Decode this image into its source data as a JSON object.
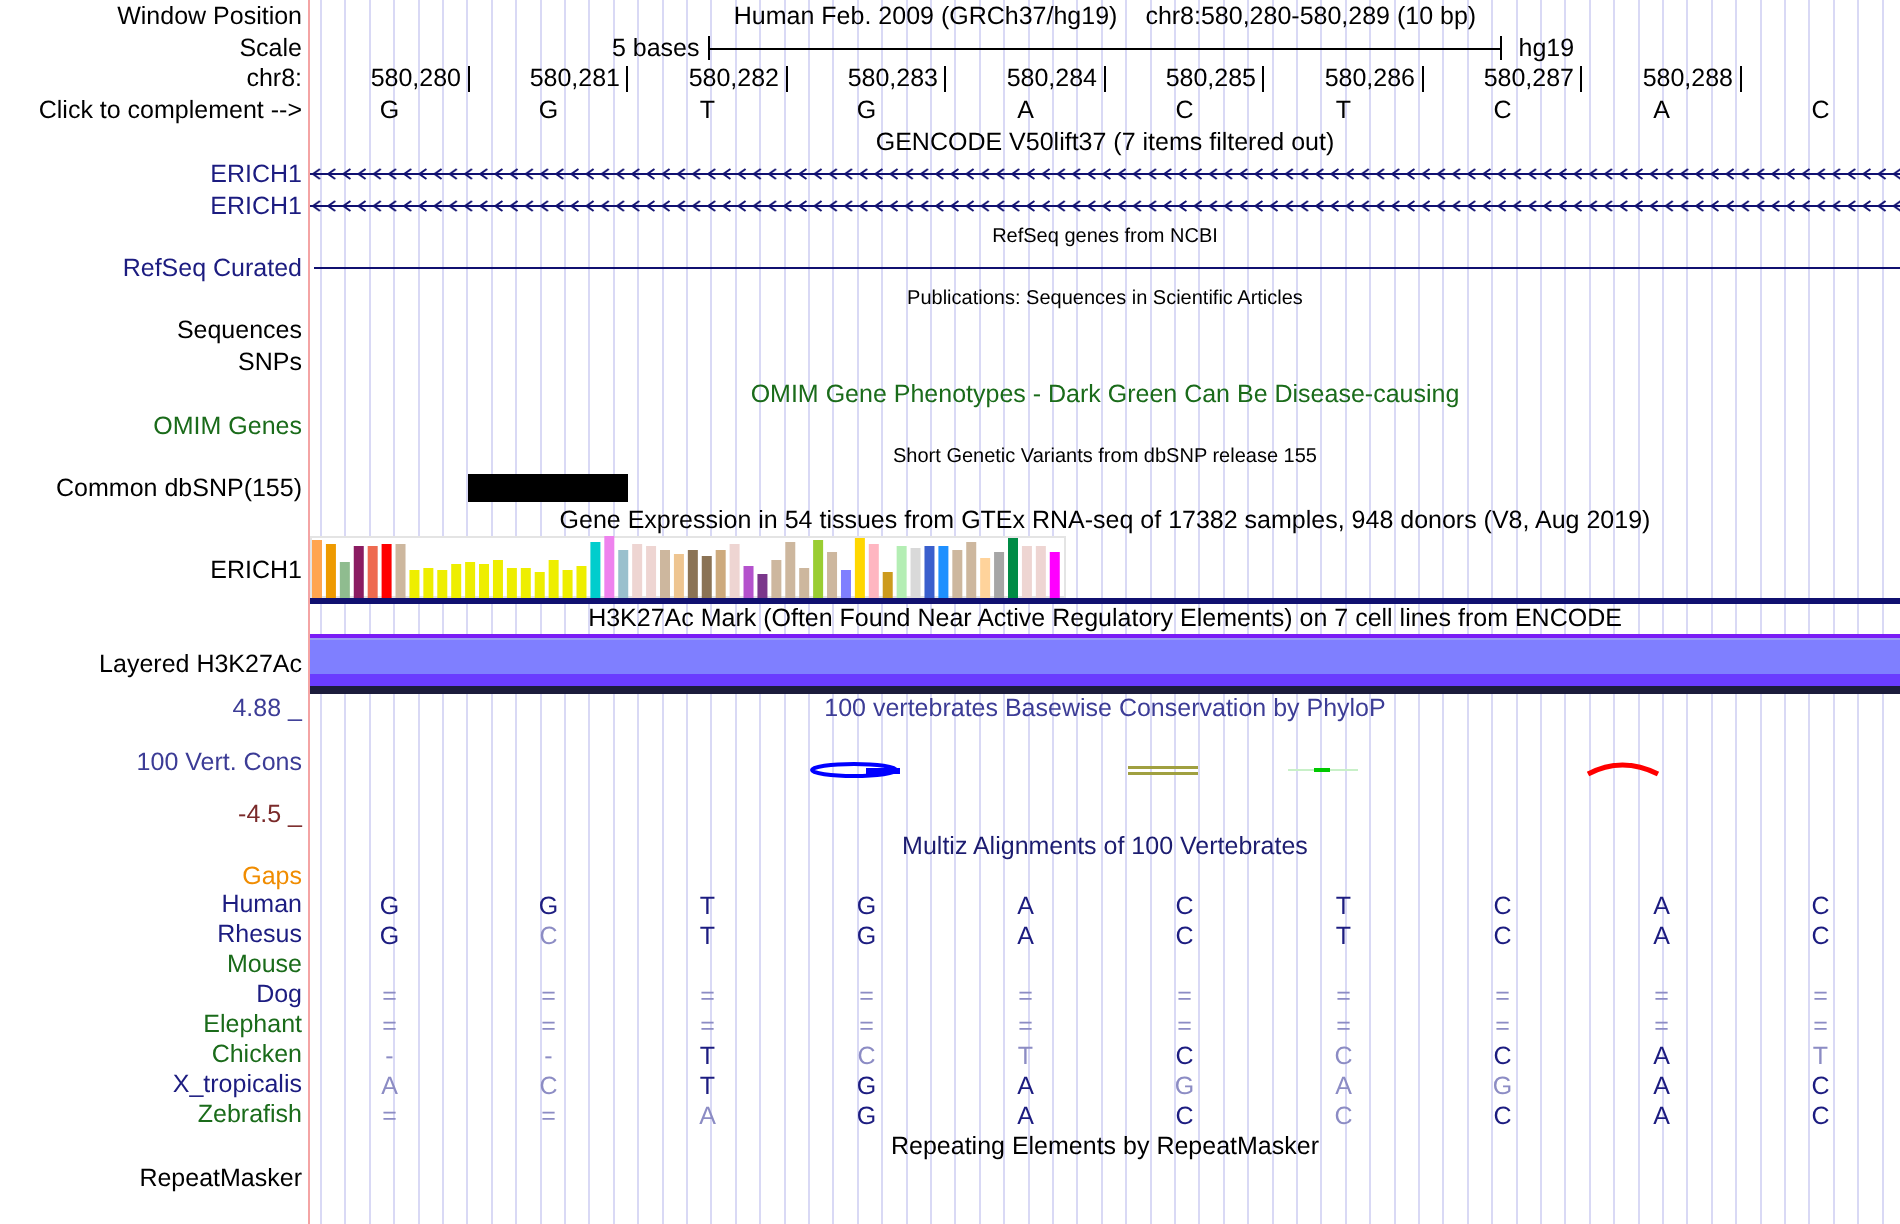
{
  "header": {
    "position_label": "Window Position",
    "title": "Human Feb. 2009 (GRCh37/hg19)",
    "location": "chr8:580,280-580,289 (10 bp)",
    "scale_label": "Scale",
    "scale_text": "5 bases",
    "assembly": "hg19",
    "chrom_label": "chr8:",
    "positions": [
      "580,280",
      "580,281",
      "580,282",
      "580,283",
      "580,284",
      "580,285",
      "580,286",
      "580,287",
      "580,288"
    ],
    "complement_label": "Click to complement -->",
    "bases": [
      "G",
      "G",
      "T",
      "G",
      "A",
      "C",
      "T",
      "C",
      "A",
      "C"
    ]
  },
  "tracks": [
    {
      "kind": "title",
      "text": "GENCODE V50lift37 (7 items filtered out)",
      "color": "#000000",
      "small": false
    },
    {
      "kind": "gene",
      "label": "ERICH1",
      "color": "#1c1c80",
      "arrows": true
    },
    {
      "kind": "gene",
      "label": "ERICH1",
      "color": "#1c1c80",
      "arrows": true
    },
    {
      "kind": "title",
      "text": "RefSeq genes from NCBI",
      "color": "#000000",
      "small": true
    },
    {
      "kind": "gene",
      "label": "RefSeq Curated",
      "color": "#1c1c80",
      "arrows": false
    },
    {
      "kind": "title",
      "text": "Publications: Sequences in Scientific Articles",
      "color": "#000000",
      "small": true
    },
    {
      "kind": "label",
      "label": "Sequences",
      "color": "#000000"
    },
    {
      "kind": "label",
      "label": "SNPs",
      "color": "#000000"
    },
    {
      "kind": "title",
      "text": "OMIM Gene Phenotypes - Dark Green Can Be Disease-causing",
      "color": "#1a6b1a",
      "small": false
    },
    {
      "kind": "label",
      "label": "OMIM Genes",
      "color": "#1a6b1a"
    },
    {
      "kind": "title",
      "text": "Short Genetic Variants from dbSNP release 155",
      "color": "#000000",
      "small": true
    },
    {
      "kind": "snp",
      "label": "Common dbSNP(155)",
      "color": "#000000"
    },
    {
      "kind": "title",
      "text": "Gene Expression in 54 tissues from GTEx RNA-seq of 17382 samples, 948 donors (V8, Aug 2019)",
      "color": "#000000",
      "small": false
    },
    {
      "kind": "bars",
      "label": "ERICH1",
      "color": "#000000"
    },
    {
      "kind": "title",
      "text": "H3K27Ac Mark (Often Found Near Active Regulatory Elements) on 7 cell lines from ENCODE",
      "color": "#000000",
      "small": false
    },
    {
      "kind": "layered",
      "label": "Layered H3K27Ac",
      "color": "#000000"
    },
    {
      "kind": "conservation",
      "max": "4.88 _",
      "label": "100 Vert. Cons",
      "min": "-4.5 _",
      "text": "100 vertebrates Basewise Conservation by PhyloP",
      "color": "#3c3c96"
    },
    {
      "kind": "title",
      "text": "Multiz Alignments of 100 Vertebrates",
      "color": "#1c1c70",
      "small": false
    },
    {
      "kind": "alignment",
      "gaps_label": "Gaps",
      "species": [
        {
          "name": "Human",
          "color": "#1c1c80",
          "bases": [
            {
              "b": "G",
              "faint": false
            },
            {
              "b": "G",
              "faint": false
            },
            {
              "b": "T",
              "faint": false
            },
            {
              "b": "G",
              "faint": false
            },
            {
              "b": "A",
              "faint": false
            },
            {
              "b": "C",
              "faint": false
            },
            {
              "b": "T",
              "faint": false
            },
            {
              "b": "C",
              "faint": false
            },
            {
              "b": "A",
              "faint": false
            },
            {
              "b": "C",
              "faint": false
            }
          ]
        },
        {
          "name": "Rhesus",
          "color": "#1c1c80",
          "bases": [
            {
              "b": "G",
              "faint": false
            },
            {
              "b": "C",
              "faint": true
            },
            {
              "b": "T",
              "faint": false
            },
            {
              "b": "G",
              "faint": false
            },
            {
              "b": "A",
              "faint": false
            },
            {
              "b": "C",
              "faint": false
            },
            {
              "b": "T",
              "faint": false
            },
            {
              "b": "C",
              "faint": false
            },
            {
              "b": "A",
              "faint": false
            },
            {
              "b": "C",
              "faint": false
            }
          ]
        },
        {
          "name": "Mouse",
          "color": "#1a6b1a"
        },
        {
          "name": "Dog",
          "color": "#1c1c80",
          "bases": [
            {
              "b": "=",
              "faint": true
            },
            {
              "b": "=",
              "faint": true
            },
            {
              "b": "=",
              "faint": true
            },
            {
              "b": "=",
              "faint": true
            },
            {
              "b": "=",
              "faint": true
            },
            {
              "b": "=",
              "faint": true
            },
            {
              "b": "=",
              "faint": true
            },
            {
              "b": "=",
              "faint": true
            },
            {
              "b": "=",
              "faint": true
            },
            {
              "b": "=",
              "faint": true
            }
          ]
        },
        {
          "name": "Elephant",
          "color": "#1a6b1a",
          "bases": [
            {
              "b": "=",
              "faint": true
            },
            {
              "b": "=",
              "faint": true
            },
            {
              "b": "=",
              "faint": true
            },
            {
              "b": "=",
              "faint": true
            },
            {
              "b": "=",
              "faint": true
            },
            {
              "b": "=",
              "faint": true
            },
            {
              "b": "=",
              "faint": true
            },
            {
              "b": "=",
              "faint": true
            },
            {
              "b": "=",
              "faint": true
            },
            {
              "b": "=",
              "faint": true
            }
          ]
        },
        {
          "name": "Chicken",
          "color": "#1a6b1a",
          "bases": [
            {
              "b": "-",
              "faint": true
            },
            {
              "b": "-",
              "faint": true
            },
            {
              "b": "T",
              "faint": false
            },
            {
              "b": "C",
              "faint": true
            },
            {
              "b": "T",
              "faint": true
            },
            {
              "b": "C",
              "faint": false
            },
            {
              "b": "C",
              "faint": true
            },
            {
              "b": "C",
              "faint": false
            },
            {
              "b": "A",
              "faint": false
            },
            {
              "b": "T",
              "faint": true
            }
          ]
        },
        {
          "name": "X_tropicalis",
          "color": "#1c1c80",
          "bases": [
            {
              "b": "A",
              "faint": true
            },
            {
              "b": "C",
              "faint": true
            },
            {
              "b": "T",
              "faint": false
            },
            {
              "b": "G",
              "faint": false
            },
            {
              "b": "A",
              "faint": false
            },
            {
              "b": "G",
              "faint": true
            },
            {
              "b": "A",
              "faint": true
            },
            {
              "b": "G",
              "faint": true
            },
            {
              "b": "A",
              "faint": false
            },
            {
              "b": "C",
              "faint": false
            }
          ]
        },
        {
          "name": "Zebrafish",
          "color": "#1a6b1a",
          "bases": [
            {
              "b": "=",
              "faint": true
            },
            {
              "b": "=",
              "faint": true
            },
            {
              "b": "A",
              "faint": true
            },
            {
              "b": "G",
              "faint": false
            },
            {
              "b": "A",
              "faint": false
            },
            {
              "b": "C",
              "faint": false
            },
            {
              "b": "C",
              "faint": true
            },
            {
              "b": "C",
              "faint": false
            },
            {
              "b": "A",
              "faint": false
            },
            {
              "b": "C",
              "faint": false
            }
          ]
        }
      ]
    },
    {
      "kind": "title",
      "text": "Repeating Elements by RepeatMasker",
      "color": "#000000",
      "small": false
    },
    {
      "kind": "label",
      "label": "RepeatMasker",
      "color": "#000000"
    }
  ]
}
